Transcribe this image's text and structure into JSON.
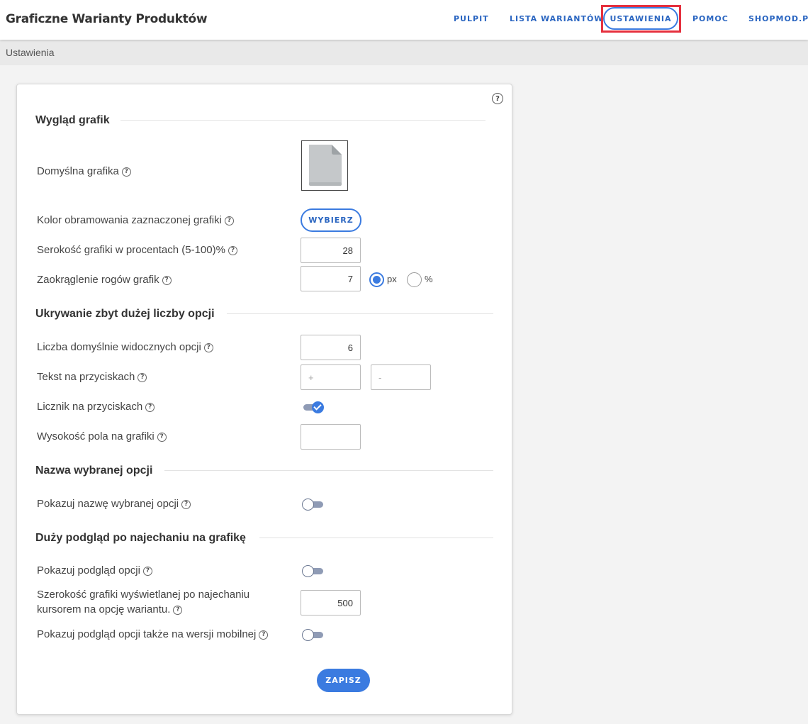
{
  "header": {
    "app_title": "Graficzne Warianty Produktów",
    "nav": [
      {
        "label": "PULPIT"
      },
      {
        "label": "LISTA WARIANTÓW"
      },
      {
        "label": "USTAWIENIA",
        "active": true
      },
      {
        "label": "POMOC"
      },
      {
        "label": "SHOPMOD.PL"
      }
    ]
  },
  "breadcrumb": "Ustawienia",
  "sections": {
    "appearance": {
      "title": "Wygląd grafik",
      "default_image_label": "Domyślna grafika",
      "border_color_label": "Kolor obramowania zaznaczonej grafiki",
      "pick_button": "WYBIERZ",
      "grayscale_label": "Serokość grafiki w procentach (5-100)%",
      "grayscale_value": "28",
      "rounding_label": "Zaokrąglenie rogów grafik",
      "rounding_value": "7",
      "unit_px": "px",
      "unit_percent": "%",
      "unit_selected": "px"
    },
    "hiding": {
      "title": "Ukrywanie zbyt dużej liczby opcji",
      "visible_count_label": "Liczba domyślnie widocznych opcji",
      "visible_count_value": "6",
      "button_text_label": "Tekst na przyciskach",
      "button_plus_placeholder": "+",
      "button_minus_placeholder": "-",
      "counter_label": "Licznik na przyciskach",
      "counter_enabled": true,
      "field_height_label": "Wysokość pola na grafiki",
      "field_height_value": ""
    },
    "selected_name": {
      "title": "Nazwa wybranej opcji",
      "show_name_label": "Pokazuj nazwę wybranej opcji",
      "show_name_enabled": false
    },
    "preview": {
      "title": "Duży podgląd po najechaniu na grafikę",
      "show_preview_label": "Pokazuj podgląd opcji",
      "show_preview_enabled": false,
      "width_label_line1": "Szerokość grafiki wyświetlanej po najechaniu",
      "width_label_line2": "kursorem na opcję wariantu.",
      "width_value": "500",
      "mobile_label": "Pokazuj podgląd opcji także na wersji mobilnej",
      "mobile_enabled": false
    }
  },
  "save_button": "ZAPISZ",
  "help_glyph": "?",
  "colors": {
    "accent": "#3b7be0",
    "nav_text": "#2b66c1",
    "highlight_box": "#e5303e"
  }
}
